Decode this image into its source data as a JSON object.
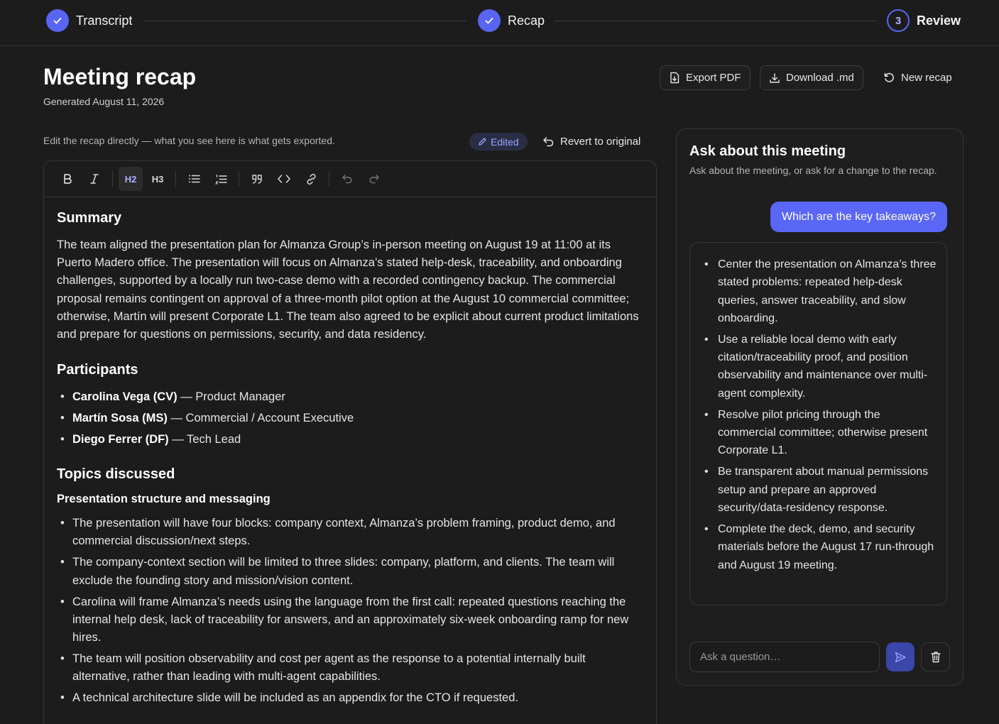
{
  "stepper": {
    "steps": [
      {
        "label": "Transcript",
        "state": "done"
      },
      {
        "label": "Recap",
        "state": "done"
      },
      {
        "label": "Review",
        "state": "active",
        "number": "3"
      }
    ]
  },
  "header": {
    "title": "Meeting recap",
    "subtitle": "Generated August 11, 2026",
    "export_pdf": "Export PDF",
    "download_md": "Download .md",
    "new_recap": "New recap"
  },
  "editbar": {
    "hint": "Edit the recap directly — what you see here is what gets exported.",
    "edited_badge": "Edited",
    "revert": "Revert to original"
  },
  "toolbar": {
    "h2": "H2",
    "h3": "H3"
  },
  "doc": {
    "summary_heading": "Summary",
    "summary_text": "The team aligned the presentation plan for Almanza Group’s in-person meeting on August 19 at 11:00 at its Puerto Madero office. The presentation will focus on Almanza’s stated help-desk, traceability, and onboarding challenges, supported by a locally run two-case demo with a recorded contingency backup. The commercial proposal remains contingent on approval of a three-month pilot option at the August 10 commercial committee; otherwise, Martín will present Corporate L1. The team also agreed to be explicit about current product limitations and prepare for questions on permissions, security, and data residency.",
    "participants_heading": "Participants",
    "participants": [
      {
        "name": "Carolina Vega (CV)",
        "role": " — Product Manager"
      },
      {
        "name": "Martín Sosa (MS)",
        "role": " — Commercial / Account Executive"
      },
      {
        "name": "Diego Ferrer (DF)",
        "role": " — Tech Lead"
      }
    ],
    "topics_heading": "Topics discussed",
    "subtopic_heading": "Presentation structure and messaging",
    "topics": [
      "The presentation will have four blocks: company context, Almanza’s problem framing, product demo, and commercial discussion/next steps.",
      "The company-context section will be limited to three slides: company, platform, and clients. The team will exclude the founding story and mission/vision content.",
      "Carolina will frame Almanza’s needs using the language from the first call: repeated questions reaching the internal help desk, lack of traceability for answers, and an approximately six-week onboarding ramp for new hires.",
      "The team will position observability and cost per agent as the response to a potential internally built alternative, rather than leading with multi-agent capabilities.",
      "A technical architecture slide will be included as an appendix for the CTO if requested."
    ]
  },
  "chat": {
    "title": "Ask about this meeting",
    "subtitle": "Ask about the meeting, or ask for a change to the recap.",
    "user_message": "Which are the key takeaways?",
    "answer_items": [
      "Center the presentation on Almanza’s three stated problems: repeated help-desk queries, answer traceability, and slow onboarding.",
      "Use a reliable local demo with early citation/traceability proof, and position observability and maintenance over multi-agent complexity.",
      "Resolve pilot pricing through the commercial committee; otherwise present Corporate L1.",
      "Be transparent about manual permissions setup and prepare an approved security/data-residency response.",
      "Complete the deck, demo, and security materials before the August 17 run-through and August 19 meeting."
    ],
    "input_placeholder": "Ask a question…"
  },
  "colors": {
    "accent": "#5865f2",
    "background": "#1c1c1c"
  }
}
